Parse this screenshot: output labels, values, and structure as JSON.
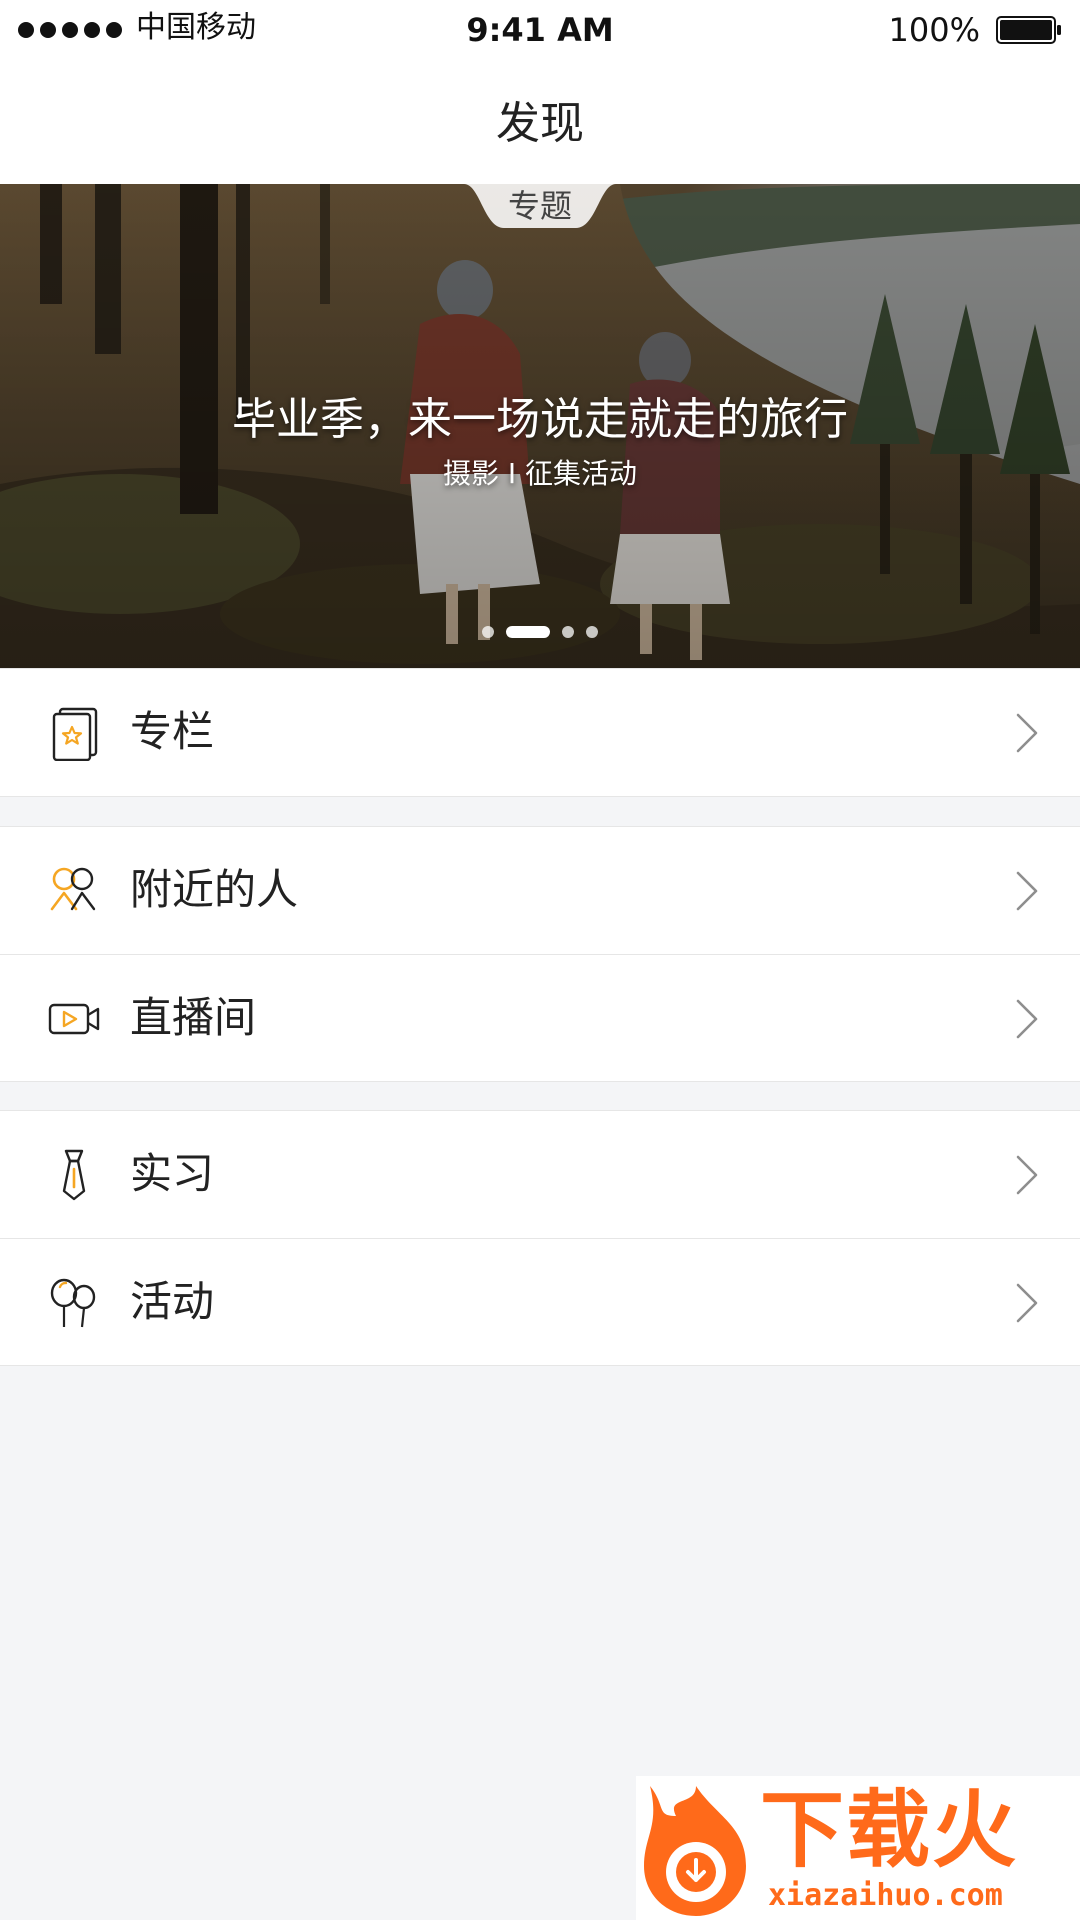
{
  "status_bar": {
    "carrier": "中国移动",
    "time": "9:41 AM",
    "battery": "100%"
  },
  "header": {
    "title": "发现"
  },
  "banner": {
    "tab_label": "专题",
    "title": "毕业季，来一场说走就走的旅行",
    "subtitle": "摄影 I 征集活动",
    "page_count": 4,
    "active_page": 2
  },
  "menu": {
    "groups": [
      {
        "items": [
          {
            "label": "专栏",
            "icon": "column-card-icon"
          }
        ]
      },
      {
        "items": [
          {
            "label": "附近的人",
            "icon": "nearby-people-icon"
          },
          {
            "label": "直播间",
            "icon": "live-video-icon"
          }
        ]
      },
      {
        "items": [
          {
            "label": "实习",
            "icon": "tie-icon"
          },
          {
            "label": "活动",
            "icon": "balloons-icon"
          }
        ]
      }
    ]
  },
  "watermark": {
    "brand": "下载火",
    "url": "xiazaihuo.com"
  },
  "colors": {
    "accent": "#f5a623",
    "background": "#f4f5f7",
    "watermark": "#ff6a1a"
  }
}
